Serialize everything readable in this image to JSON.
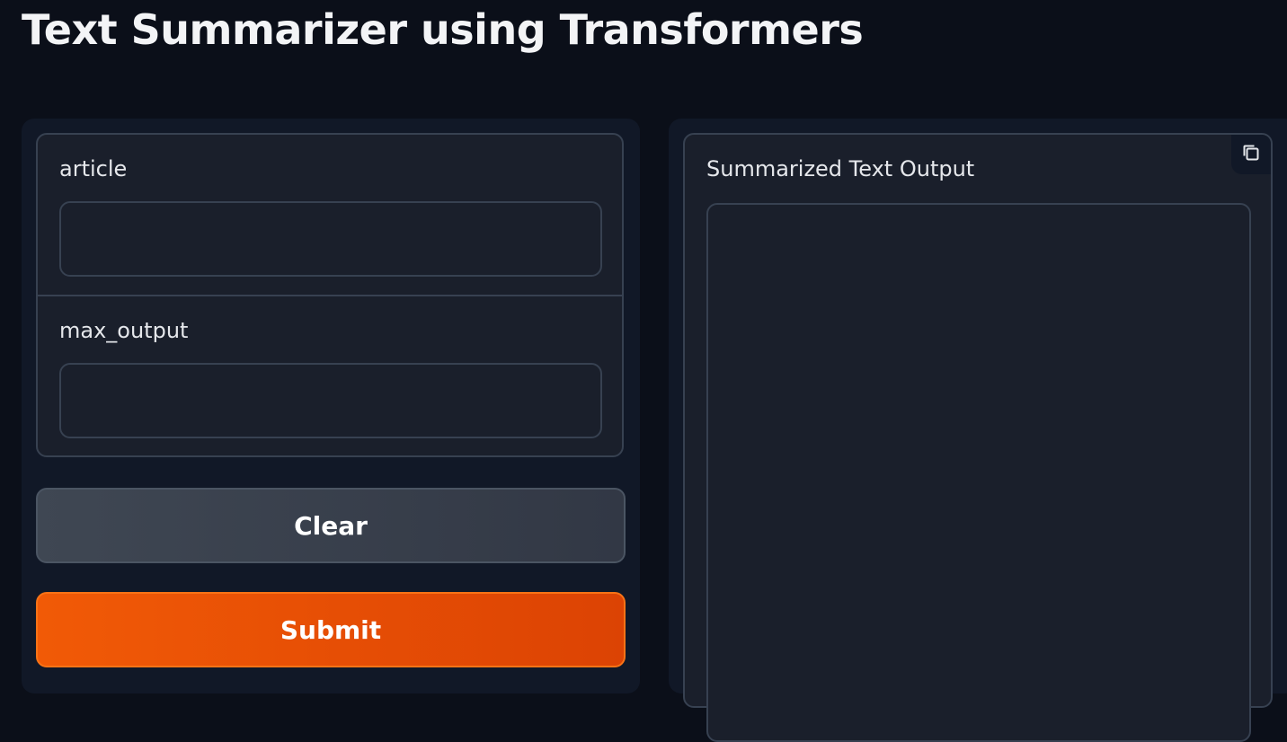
{
  "app": {
    "title": "Text Summarizer using Transformers"
  },
  "inputs": {
    "article": {
      "label": "article",
      "value": "",
      "placeholder": ""
    },
    "max_output": {
      "label": "max_output",
      "value": "",
      "placeholder": ""
    }
  },
  "buttons": {
    "clear_label": "Clear",
    "submit_label": "Submit"
  },
  "output": {
    "label": "Summarized Text Output",
    "value": "",
    "copy_icon": "copy-icon"
  },
  "colors": {
    "background": "#0b0f19",
    "panel": "#111827",
    "block": "#1a1f2b",
    "border": "#374151",
    "accent": "#f15a06",
    "secondary_button": "#3f4753"
  }
}
